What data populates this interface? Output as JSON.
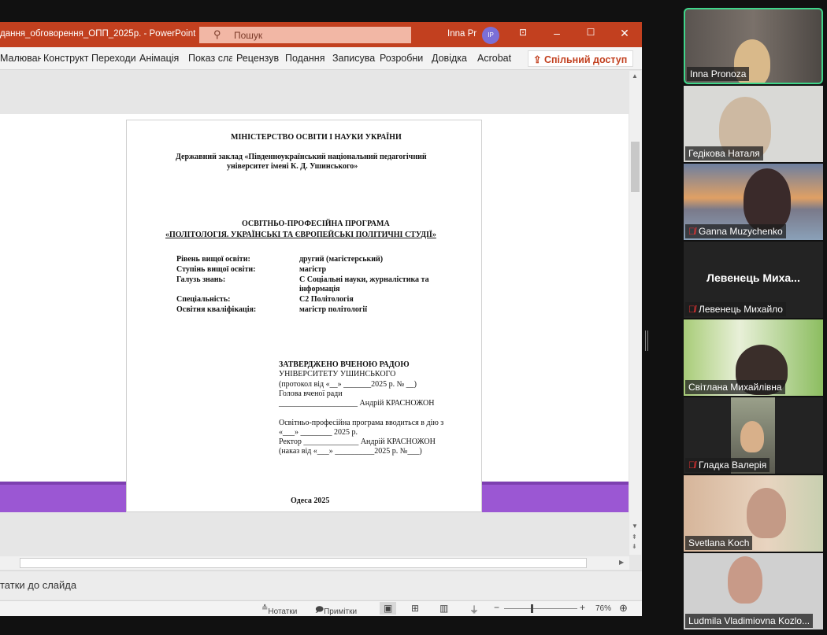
{
  "window": {
    "title": "дання_обговорення_ОПП_2025р.  -  PowerPoint",
    "search_placeholder": "Пошук",
    "user": "Inna Pr",
    "avatar_initials": "IP"
  },
  "ribbon": {
    "tabs": [
      "Малюван",
      "Конструкт",
      "Переходи",
      "Анімація",
      "Показ сла",
      "Рецензув",
      "Подання",
      "Записува",
      "Розробни",
      "Довідка",
      "Acrobat"
    ],
    "share": "Спільний доступ"
  },
  "document": {
    "ministry": "МІНІСТЕРСТВО ОСВІТИ І НАУКИ УКРАЇНИ",
    "institution_1": "Державний заклад «Південноукраїнський національний педагогічний",
    "institution_2": "університет імені К. Д. Ушинського»",
    "program_type": "ОСВІТНЬО-ПРОФЕСІЙНА ПРОГРАМА",
    "program_name": "«ПОЛІТОЛОГІЯ. УКРАЇНСЬКІ ТА ЄВРОПЕЙСЬКІ ПОЛІТИЧНІ СТУДІЇ»",
    "fields": [
      {
        "label": "Рівень вищої освіти:",
        "value": "другий (магістерський)"
      },
      {
        "label": "Ступінь вищої освіти:",
        "value": "магістр"
      },
      {
        "label": "Галузь знань:",
        "value": "C Соціальні науки, журналістика та",
        "value2": "інформація"
      },
      {
        "label": "Спеціальність:",
        "value": "C2 Політологія"
      },
      {
        "label": "Освітня кваліфікація:",
        "value": "магістр політології"
      }
    ],
    "approval": [
      "ЗАТВЕРДЖЕНО ВЧЕНОЮ РАДОЮ",
      "УНІВЕРСИТЕТУ УШИНСЬКОГО",
      "(протокол від «__» _______2025 р. № __)",
      "Голова вченої ради",
      "____________________ Андрій КРАСНОЖОН",
      "Освітньо-професійна програма вводиться в дію з",
      "«___»  ________  2025 р.",
      "Ректор ______________ Андрій КРАСНОЖОН",
      "(наказ від «___» __________2025 р. №___)"
    ],
    "city_year": "Одеса 2025"
  },
  "notes": {
    "placeholder": "татки до слайда"
  },
  "status": {
    "notes": "Нотатки",
    "comments": "Примітки",
    "zoom_minus": "−",
    "zoom_plus": "+",
    "zoom": "76%",
    "zoom_fraction": 0.38
  },
  "participants": [
    {
      "name": "Inna Pronoza",
      "muted": false,
      "active": true
    },
    {
      "name": "Гедікова Наталя",
      "muted": false
    },
    {
      "name": "Ganna Muzychenko",
      "muted": true
    },
    {
      "name": "Левенець Михайло",
      "muted": true,
      "display": "Левенець  Миха..."
    },
    {
      "name": "Світлана Михайлівна",
      "muted": false
    },
    {
      "name": "Гладка Валерія",
      "muted": true
    },
    {
      "name": "Svetlana Koch",
      "muted": false
    },
    {
      "name": "Ludmila Vladimiovna Kozlo...",
      "muted": false
    }
  ]
}
